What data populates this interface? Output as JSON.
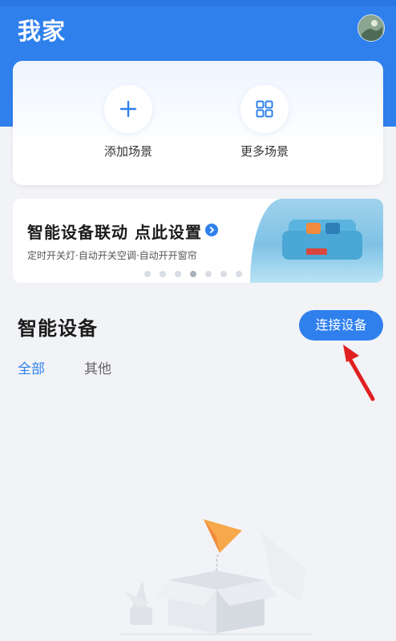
{
  "header": {
    "title": "我家"
  },
  "scenes": {
    "add_label": "添加场景",
    "more_label": "更多场景"
  },
  "banner": {
    "title": "智能设备联动 点此设置",
    "subtitle": "定时开关灯·自动开关空调·自动开开窗帘",
    "page_count": 7,
    "active_page": 4
  },
  "devices": {
    "title": "智能设备",
    "connect_label": "连接设备",
    "tabs": [
      "全部",
      "其他"
    ],
    "active_tab": "全部"
  },
  "colors": {
    "accent": "#2f80ed",
    "annotation": "#e02020"
  }
}
